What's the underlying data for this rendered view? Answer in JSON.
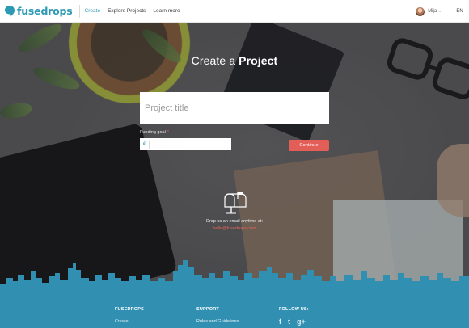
{
  "header": {
    "logo_text": "fusedrops",
    "nav": [
      "Create",
      "Explore Projects",
      "Learn more"
    ],
    "user_name": "Mija",
    "caret": "⌵",
    "language": "EN"
  },
  "hero": {
    "title_prefix": "Create a",
    "title_strong": "Project",
    "project_title_placeholder": "Project title",
    "funding_label": "Funding goal",
    "required_mark": "*",
    "currency_symbol": "€",
    "continue_label": "Continue",
    "drop_text": "Drop us an email anytime at:",
    "email": "hello@fusedrops.com"
  },
  "footer": {
    "col1_heading": "FUSEDROPS",
    "col1_link": "Create",
    "col2_heading": "SUPPORT",
    "col2_link": "Rules and Guidelines",
    "col3_heading": "FOLLOW US:",
    "social": [
      "f",
      "t",
      "g+"
    ]
  },
  "colors": {
    "brand": "#2c9ab4",
    "accent": "#e35e57",
    "footer": "#3190b2"
  }
}
